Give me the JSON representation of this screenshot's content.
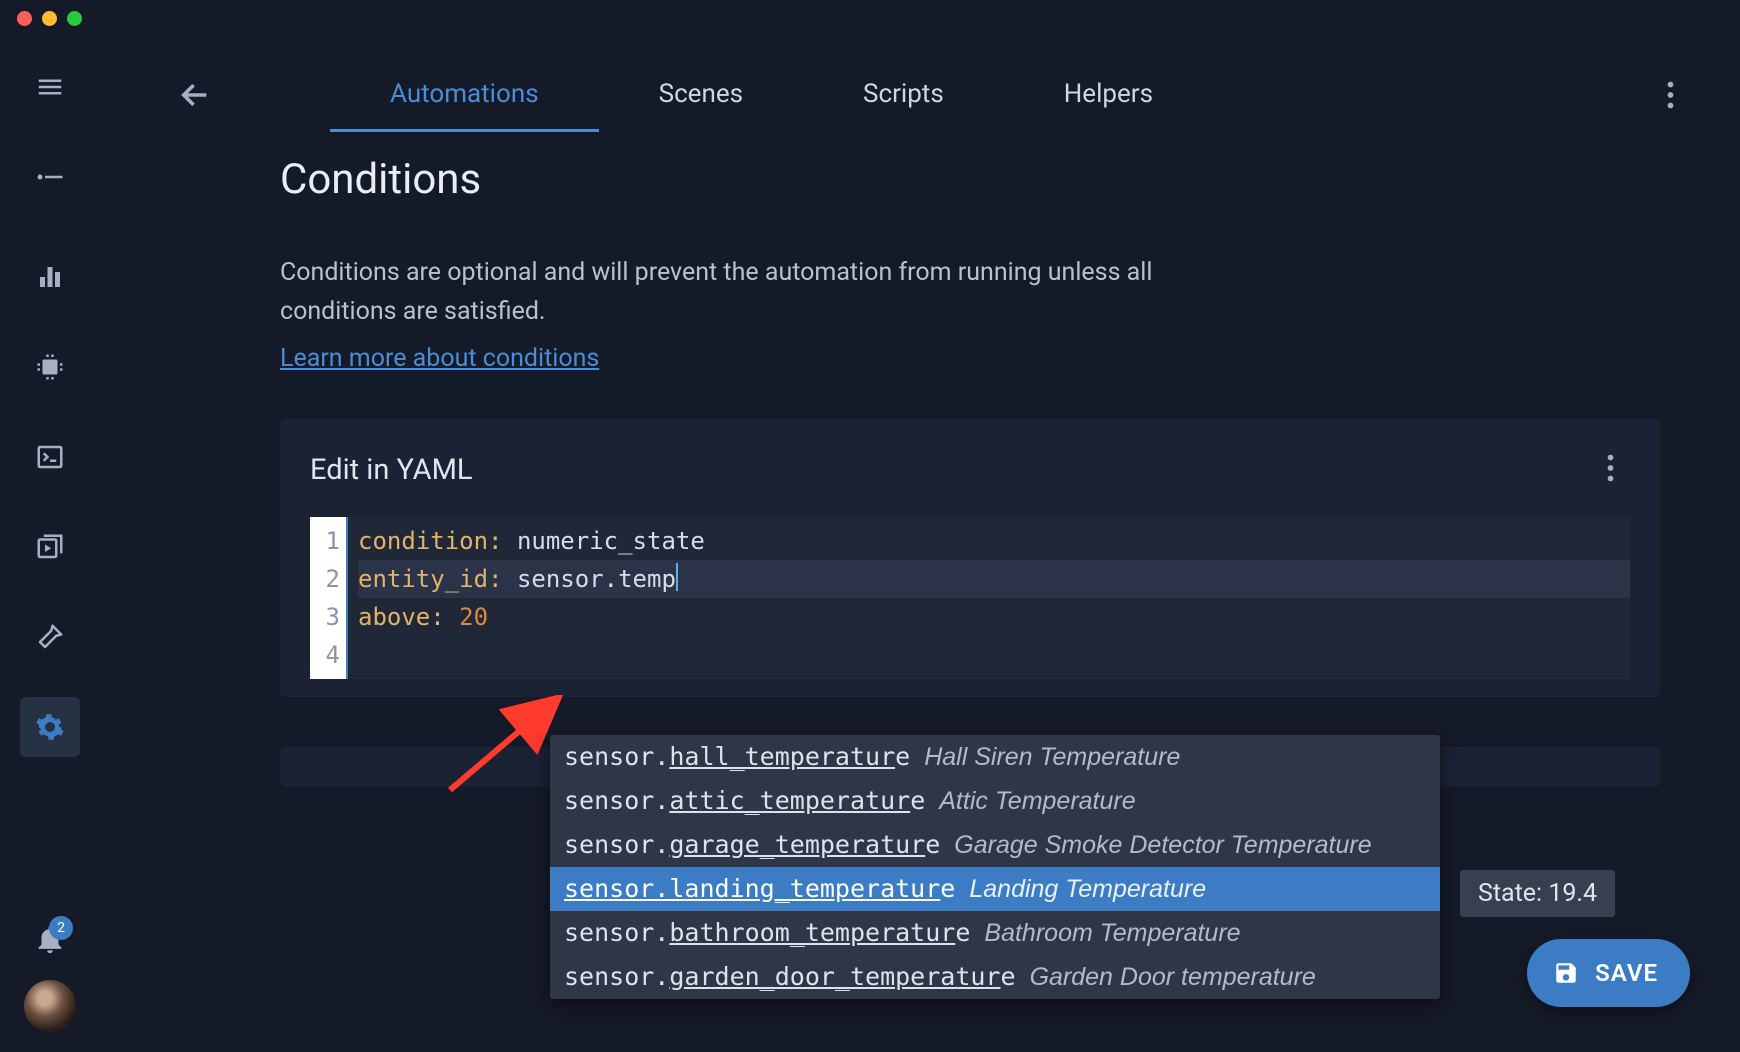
{
  "tabs": [
    {
      "label": "Automations",
      "active": true
    },
    {
      "label": "Scenes",
      "active": false
    },
    {
      "label": "Scripts",
      "active": false
    },
    {
      "label": "Helpers",
      "active": false
    }
  ],
  "sidebar": {
    "notification_count": "2"
  },
  "page": {
    "title": "Conditions",
    "description": "Conditions are optional and will prevent the automation from running unless all conditions are satisfied.",
    "learn_label": "Learn more about conditions"
  },
  "card": {
    "title": "Edit in YAML"
  },
  "editor": {
    "lines": {
      "l1_key": "condition:",
      "l1_val": " numeric_state",
      "l2_key": "entity_id:",
      "l2_val": " sensor.temp",
      "l3_key": "above:",
      "l3_val": " 20"
    },
    "line_numbers": [
      "1",
      "2",
      "3",
      "4"
    ]
  },
  "autocomplete": {
    "options": [
      {
        "id": "sensor.hall_temperature",
        "desc": "Hall Siren Temperature",
        "underline": [
          7,
          22
        ],
        "selected": false
      },
      {
        "id": "sensor.attic_temperature",
        "desc": "Attic Temperature",
        "underline": [
          7,
          23
        ],
        "selected": false
      },
      {
        "id": "sensor.garage_temperature",
        "desc": "Garage Smoke Detector Temperature",
        "underline": [
          7,
          24
        ],
        "selected": false
      },
      {
        "id": "sensor.landing_temperature",
        "desc": "Landing Temperature",
        "underline": [
          0,
          25
        ],
        "selected": true
      },
      {
        "id": "sensor.bathroom_temperature",
        "desc": "Bathroom Temperature",
        "underline": [
          7,
          26
        ],
        "selected": false
      },
      {
        "id": "sensor.garden_door_temperature",
        "desc": "Garden Door temperature",
        "underline": [
          7,
          29
        ],
        "selected": false
      }
    ],
    "state_label": "State: 19.4"
  },
  "save": {
    "label": "SAVE"
  }
}
